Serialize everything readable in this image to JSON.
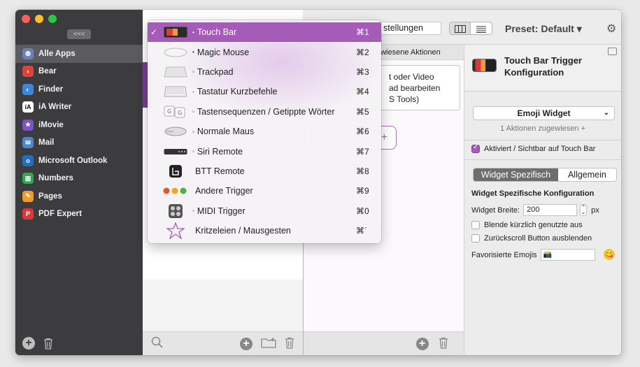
{
  "sidebar": {
    "collapse_label": "<<<",
    "apps": [
      {
        "label": "Alle Apps",
        "icon": "globe-icon",
        "color": "#6b7fb8",
        "glyph": "◍",
        "selected": true
      },
      {
        "label": "Bear",
        "icon": "bear-icon",
        "color": "#d8433b",
        "glyph": "◗"
      },
      {
        "label": "Finder",
        "icon": "finder-icon",
        "color": "#3d86d8",
        "glyph": "◐"
      },
      {
        "label": "iA Writer",
        "icon": "ia-writer-icon",
        "color": "#ffffff",
        "glyph": "iA"
      },
      {
        "label": "iMovie",
        "icon": "star-icon",
        "color": "#7b53c4",
        "glyph": "★"
      },
      {
        "label": "Mail",
        "icon": "mail-icon",
        "color": "#4f86c8",
        "glyph": "✉"
      },
      {
        "label": "Microsoft Outlook",
        "icon": "outlook-icon",
        "color": "#1f6fc2",
        "glyph": "o"
      },
      {
        "label": "Numbers",
        "icon": "numbers-icon",
        "color": "#2fa84f",
        "glyph": "▥"
      },
      {
        "label": "Pages",
        "icon": "pages-icon",
        "color": "#f39a2a",
        "glyph": "✎"
      },
      {
        "label": "PDF Expert",
        "icon": "pdf-icon",
        "color": "#d9393a",
        "glyph": "P"
      }
    ]
  },
  "toolbar": {
    "settings_label": "stellungen",
    "preset_label": "Preset: Default ▾"
  },
  "triggers": {
    "column_title": "ewiesene Aktionen",
    "card_lines": [
      "t oder Video",
      "ad bearbeiten",
      "S Tools)"
    ],
    "add_symbol": "+"
  },
  "config": {
    "title_line1": "Touch Bar Trigger",
    "title_line2": "Konfiguration",
    "widget_select": "Emoji Widget",
    "assigned_text": "1 Aktionen zugewiesen +",
    "visible_label": "Aktiviert / Sichtbar auf Touch Bar",
    "tab_specific": "Widget Spezifisch",
    "tab_general": "Allgemein",
    "section_title": "Widget Spezifische Konfiguration",
    "width_label": "Widget Breite:",
    "width_value": "200",
    "width_unit": "px",
    "hide_recent_label": "Blende kürzlich genutzte aus",
    "hide_back_label": "Zurückscroll Button ausblenden",
    "fav_label": "Favorisierte Emojis",
    "fav_value": "📸",
    "emoji_button": "😋"
  },
  "dropdown": {
    "items": [
      {
        "label": "Touch Bar",
        "shortcut": "⌘1",
        "icon": "touch-bar-icon",
        "checked": true,
        "dot": "•"
      },
      {
        "label": "Magic Mouse",
        "shortcut": "⌘2",
        "icon": "magic-mouse-icon",
        "dot": "•"
      },
      {
        "label": "Trackpad",
        "shortcut": "⌘3",
        "icon": "trackpad-icon",
        "dot": "◦"
      },
      {
        "label": "Tastatur Kurzbefehle",
        "shortcut": "⌘4",
        "icon": "keyboard-icon",
        "dot": "◦"
      },
      {
        "label": "Tastensequenzen / Getippte Wörter",
        "shortcut": "⌘5",
        "icon": "key-sequence-icon",
        "dot": "◦"
      },
      {
        "label": "Normale Maus",
        "shortcut": "⌘6",
        "icon": "mouse-icon",
        "dot": "◦"
      },
      {
        "label": "Siri Remote",
        "shortcut": "⌘7",
        "icon": "siri-remote-icon",
        "dot": "◦"
      },
      {
        "label": "BTT Remote",
        "shortcut": "⌘8",
        "icon": "btt-remote-icon",
        "dot": ""
      },
      {
        "label": "Andere Trigger",
        "shortcut": "⌘9",
        "icon": "traffic-dots-icon",
        "dot": ""
      },
      {
        "label": "MIDI Trigger",
        "shortcut": "⌘0",
        "icon": "midi-icon",
        "dot": "◦"
      },
      {
        "label": "Kritzeleien / Mausgesten",
        "shortcut": "⌘´",
        "icon": "gesture-star-icon",
        "dot": ""
      }
    ]
  }
}
